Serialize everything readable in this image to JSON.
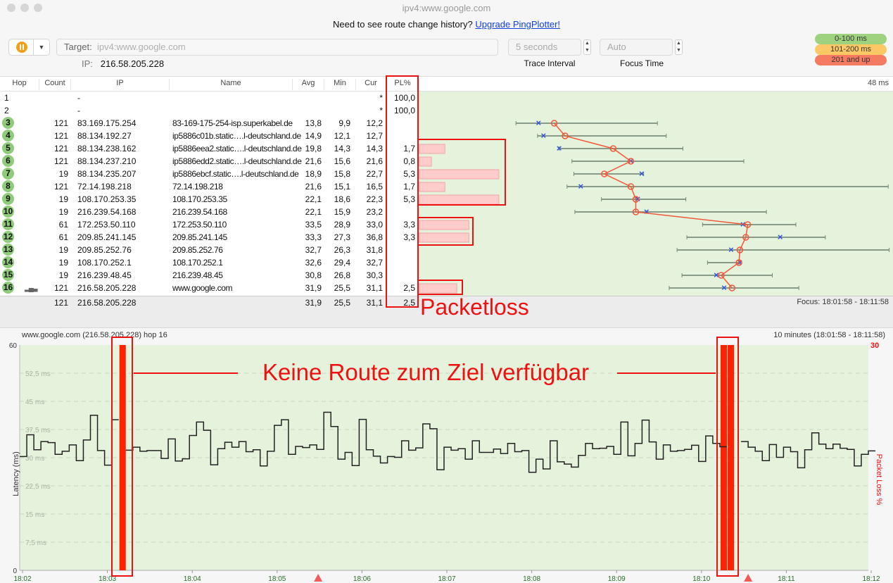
{
  "window": {
    "title": "ipv4:www.google.com"
  },
  "promo": {
    "text": "Need to see route change history?",
    "link": "Upgrade PingPlotter!"
  },
  "toolbar": {
    "pause_icon": "pause-icon",
    "target_label": "Target:",
    "target_placeholder": "ipv4:www.google.com",
    "ip_label": "IP:",
    "ip_value": "216.58.205.228",
    "interval_value": "5 seconds",
    "interval_label": "Trace Interval",
    "focus_value": "Auto",
    "focus_label": "Focus Time"
  },
  "legend": [
    {
      "label": "0-100 ms",
      "color": "#9fd27f"
    },
    {
      "label": "101-200 ms",
      "color": "#fcc865"
    },
    {
      "label": "201 and up",
      "color": "#f57a62"
    }
  ],
  "table": {
    "columns": [
      "Hop",
      "Count",
      "IP",
      "Name",
      "Avg",
      "Min",
      "Cur",
      "PL%"
    ],
    "graph_scale_label": "48 ms",
    "graph_max_ms": 48,
    "rows": [
      {
        "hop": "1",
        "count": "",
        "ip": "-",
        "name": "",
        "avg": "",
        "min": "",
        "cur": "*",
        "pl": "100,0",
        "plv": 100
      },
      {
        "hop": "2",
        "count": "",
        "ip": "-",
        "name": "",
        "avg": "",
        "min": "",
        "cur": "*",
        "pl": "100,0",
        "plv": 100
      },
      {
        "hop": "3",
        "count": "121",
        "ip": "83.169.175.254",
        "name": "83-169-175-254-isp.superkabel.de",
        "avg": "13,8",
        "min": "9,9",
        "cur": "12,2",
        "pl": "",
        "plv": 0,
        "max": 24.3
      },
      {
        "hop": "4",
        "count": "121",
        "ip": "88.134.192.27",
        "name": "ip5886c01b.static….l-deutschland.de",
        "avg": "14,9",
        "min": "12,1",
        "cur": "12,7",
        "pl": "",
        "plv": 0,
        "max": 25.2
      },
      {
        "hop": "5",
        "count": "121",
        "ip": "88.134.238.162",
        "name": "ip5886eea2.static….l-deutschland.de",
        "avg": "19,8",
        "min": "14,3",
        "cur": "14,3",
        "pl": "1,7",
        "plv": 1.7,
        "max": 26.9
      },
      {
        "hop": "6",
        "count": "121",
        "ip": "88.134.237.210",
        "name": "ip5886edd2.static….l-deutschland.de",
        "avg": "21,6",
        "min": "15,6",
        "cur": "21,6",
        "pl": "0,8",
        "plv": 0.8,
        "max": 33.1
      },
      {
        "hop": "7",
        "count": "19",
        "ip": "88.134.235.207",
        "name": "ip5886ebcf.static….l-deutschland.de",
        "avg": "18,9",
        "min": "15,8",
        "cur": "22,7",
        "pl": "5,3",
        "plv": 5.3,
        "max": 22.9
      },
      {
        "hop": "8",
        "count": "121",
        "ip": "72.14.198.218",
        "name": "72.14.198.218",
        "avg": "21,6",
        "min": "15,1",
        "cur": "16,5",
        "pl": "1,7",
        "plv": 1.7,
        "max": 47.8
      },
      {
        "hop": "9",
        "count": "19",
        "ip": "108.170.253.35",
        "name": "108.170.253.35",
        "avg": "22,1",
        "min": "18,6",
        "cur": "22,3",
        "pl": "5,3",
        "plv": 5.3,
        "max": 27.2
      },
      {
        "hop": "10",
        "count": "19",
        "ip": "216.239.54.168",
        "name": "216.239.54.168",
        "avg": "22,1",
        "min": "15,9",
        "cur": "23,2",
        "pl": "",
        "plv": 0,
        "max": 35.4
      },
      {
        "hop": "11",
        "count": "61",
        "ip": "172.253.50.110",
        "name": "172.253.50.110",
        "avg": "33,5",
        "min": "28,9",
        "cur": "33,0",
        "pl": "3,3",
        "plv": 3.3,
        "max": 38.4
      },
      {
        "hop": "12",
        "count": "61",
        "ip": "209.85.241.145",
        "name": "209.85.241.145",
        "avg": "33,3",
        "min": "27,3",
        "cur": "36,8",
        "pl": "3,3",
        "plv": 3.3,
        "max": 41.4
      },
      {
        "hop": "13",
        "count": "19",
        "ip": "209.85.252.76",
        "name": "209.85.252.76",
        "avg": "32,7",
        "min": "26,3",
        "cur": "31,8",
        "pl": "",
        "plv": 0,
        "max": 47.9
      },
      {
        "hop": "14",
        "count": "19",
        "ip": "108.170.252.1",
        "name": "108.170.252.1",
        "avg": "32,6",
        "min": "29,4",
        "cur": "32,7",
        "pl": "",
        "plv": 0,
        "max": 32.7
      },
      {
        "hop": "15",
        "count": "19",
        "ip": "216.239.48.45",
        "name": "216.239.48.45",
        "avg": "30,8",
        "min": "26,8",
        "cur": "30,3",
        "pl": "",
        "plv": 0,
        "max": 36.0
      },
      {
        "hop": "16",
        "count": "121",
        "ip": "216.58.205.228",
        "name": "www.google.com",
        "avg": "31,9",
        "min": "25,5",
        "cur": "31,1",
        "pl": "2,5",
        "plv": 2.5,
        "max": 38.7
      }
    ],
    "summary": {
      "count": "121",
      "ip": "216.58.205.228",
      "avg": "31,9",
      "min": "25,5",
      "cur": "31,1",
      "pl": "2,5"
    },
    "focus": "Focus: 18:01:58 - 18:11:58"
  },
  "annotations": {
    "packetloss": "Packetloss",
    "no_route": "Keine Route zum Ziel verfügbar"
  },
  "chart_data": {
    "type": "line",
    "title": "www.google.com (216.58.205.228) hop 16",
    "range_label": "10 minutes (18:01:58 - 18:11:58)",
    "ylabel": "Latency (ms)",
    "y2label": "Packet Loss %",
    "ylim": [
      0,
      60
    ],
    "y2lim": [
      0,
      30
    ],
    "y2_top_label": "30",
    "yticks": [
      "0",
      "7,5 ms",
      "15 ms",
      "22,5 ms",
      "30 ms",
      "37,5 ms",
      "45 ms",
      "52,5 ms",
      "60"
    ],
    "xticks": [
      "18:02",
      "18:03",
      "18:04",
      "18:05",
      "18:06",
      "18:07",
      "18:08",
      "18:09",
      "18:10",
      "18:11",
      "18:12"
    ],
    "x_start": "18:01:58",
    "x_end": "18:11:58",
    "sample_interval_s": 5,
    "grid": true,
    "latency_ms": [
      30.3,
      36.1,
      32.1,
      34.3,
      34.0,
      30.9,
      31.7,
      33.4,
      29.2,
      34.7,
      41.3,
      31.9,
      28.0,
      40.1,
      null,
      32.0,
      32.8,
      31.7,
      31.9,
      31.9,
      29.8,
      35.0,
      29.1,
      29.7,
      35.9,
      39.5,
      37.3,
      28.1,
      32.4,
      34.1,
      32.8,
      34.3,
      31.6,
      32.1,
      27.8,
      31.7,
      38.6,
      40.1,
      30.9,
      33.0,
      32.7,
      33.4,
      32.2,
      42.1,
      38.3,
      29.6,
      31.4,
      27.9,
      40.2,
      32.1,
      30.4,
      28.6,
      30.3,
      30.1,
      34.5,
      32.0,
      32.6,
      39.0,
      37.7,
      26.8,
      32.8,
      32.0,
      32.4,
      29.6,
      34.5,
      31.4,
      31.4,
      32.3,
      31.1,
      33.8,
      31.6,
      31.9,
      26.1,
      29.6,
      27.0,
      34.5,
      28.9,
      28.3,
      27.5,
      30.6,
      33.8,
      32.4,
      32.5,
      33.0,
      30.9,
      39.5,
      30.5,
      33.8,
      40.0,
      34.2,
      29.6,
      33.4,
      31.7,
      31.9,
      32.2,
      33.3,
      29.0,
      35.8,
      33.8,
      32.9,
      null,
      null,
      34.3,
      32.8,
      31.7,
      29.2,
      33.5,
      30.1,
      32.8,
      31.6,
      27.3,
      32.1,
      36.6,
      33.6,
      32.4,
      33.6,
      32.5,
      32.2,
      27.8,
      30.9,
      31.8
    ],
    "packet_loss_pct": {
      "14": 100,
      "99": 100,
      "100": 100
    },
    "route_change_markers": [
      "18:05:29",
      "18:10:33"
    ],
    "colors": {
      "line": "#222222",
      "loss": "#ff2200",
      "background": "#e6f3dc",
      "axis_time": "#2a6a2a"
    }
  }
}
